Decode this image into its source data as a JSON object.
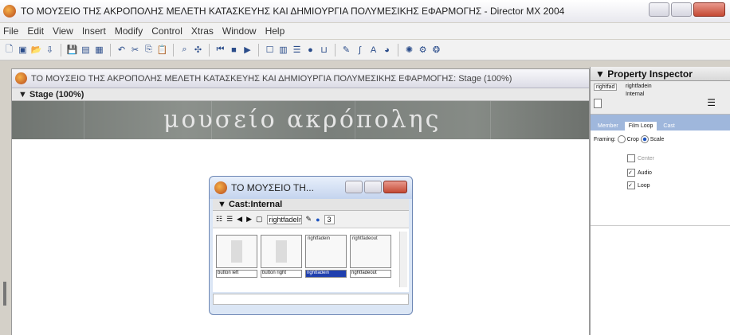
{
  "app": {
    "title": "ΤΟ ΜΟΥΣΕΙΟ ΤΗΣ ΑΚΡΟΠΟΛΗΣ ΜΕΛΕΤΗ ΚΑΤΑΣΚΕΥΗΣ ΚΑΙ ΔΗΜΙΟΥΡΓΙΑ ΠΟΛΥΜΕΣΙΚΗΣ ΕΦΑΡΜΟΓΗΣ - Director MX 2004"
  },
  "menu": [
    "File",
    "Edit",
    "View",
    "Insert",
    "Modify",
    "Control",
    "Xtras",
    "Window",
    "Help"
  ],
  "stage": {
    "window_title": "ΤΟ ΜΟΥΣΕΙΟ ΤΗΣ ΑΚΡΟΠΟΛΗΣ ΜΕΛΕΤΗ ΚΑΤΑΣΚΕΥΗΣ ΚΑΙ ΔΗΜΙΟΥΡΓΙΑ ΠΟΛΥΜΕΣΙΚΗΣ ΕΦΑΡΜΟΓΗΣ: Stage (100%)",
    "panel_label": "▼ Stage (100%)",
    "banner_text": "μουσείο   ακρόπολης"
  },
  "cast": {
    "window_title": "ΤΟ ΜΟΥΣΕΙΟ ΤΗ...",
    "panel_label": "▼ Cast:Internal",
    "tool_field": "rightfadeIn",
    "tool_number": "3",
    "members": [
      {
        "label": "button left",
        "mini": "",
        "selected": false
      },
      {
        "label": "button right",
        "mini": "",
        "selected": false
      },
      {
        "label": "rightfadein",
        "mini": "rightfadein",
        "selected": true
      },
      {
        "label": "rightfadeout",
        "mini": "rightfadeout",
        "selected": false
      }
    ]
  },
  "property_inspector": {
    "title": "▼ Property Inspector",
    "field_name": "rightfad",
    "field_value": "rightfadein",
    "field_sub": "Internal",
    "tabs": [
      "Member",
      "Film Loop",
      "Cast"
    ],
    "framing_label": "Framing:",
    "crop_label": "Crop",
    "scale_label": "Scale",
    "center_label": "Center",
    "audio_label": "Audio",
    "loop_label": "Loop"
  },
  "colors": {
    "accent": "#1f3fae",
    "tab_bar": "#9fb7dc",
    "close_red": "#c44a34"
  }
}
